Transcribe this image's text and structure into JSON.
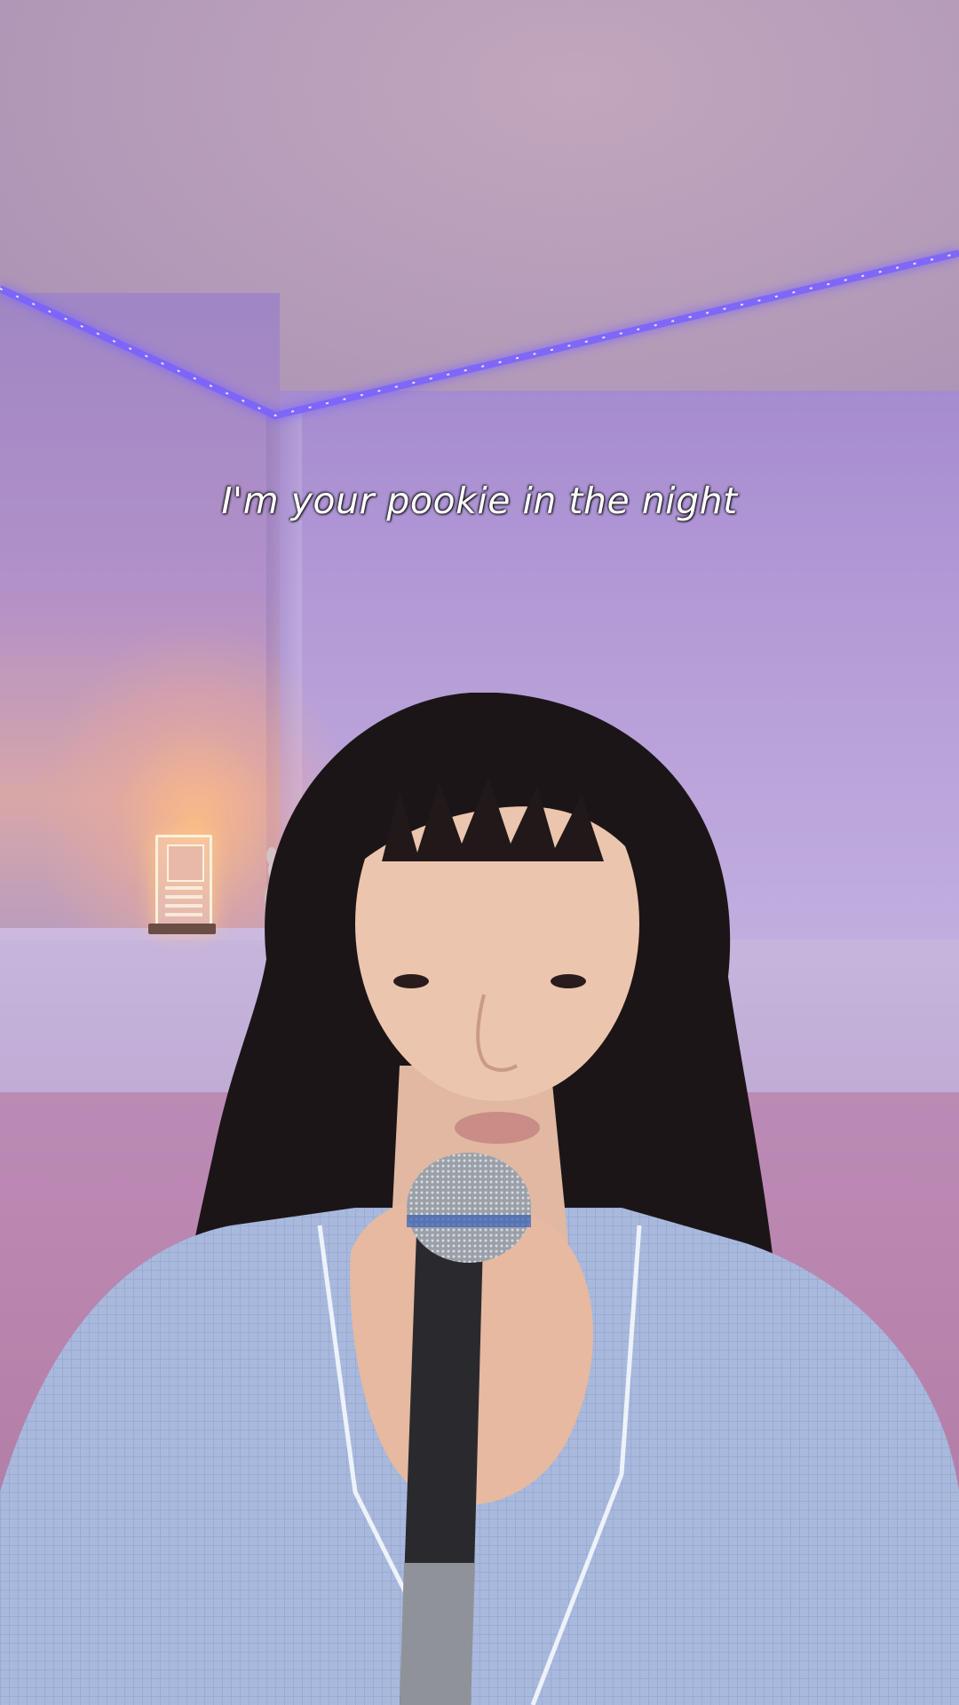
{
  "video": {
    "caption": "I'm your pookie in the night"
  },
  "icons": [
    "microphone-icon"
  ],
  "colors": {
    "led_strip": "#6f62ff",
    "wall_tint": "#b49ad6",
    "caption_text": "#ffffff"
  }
}
